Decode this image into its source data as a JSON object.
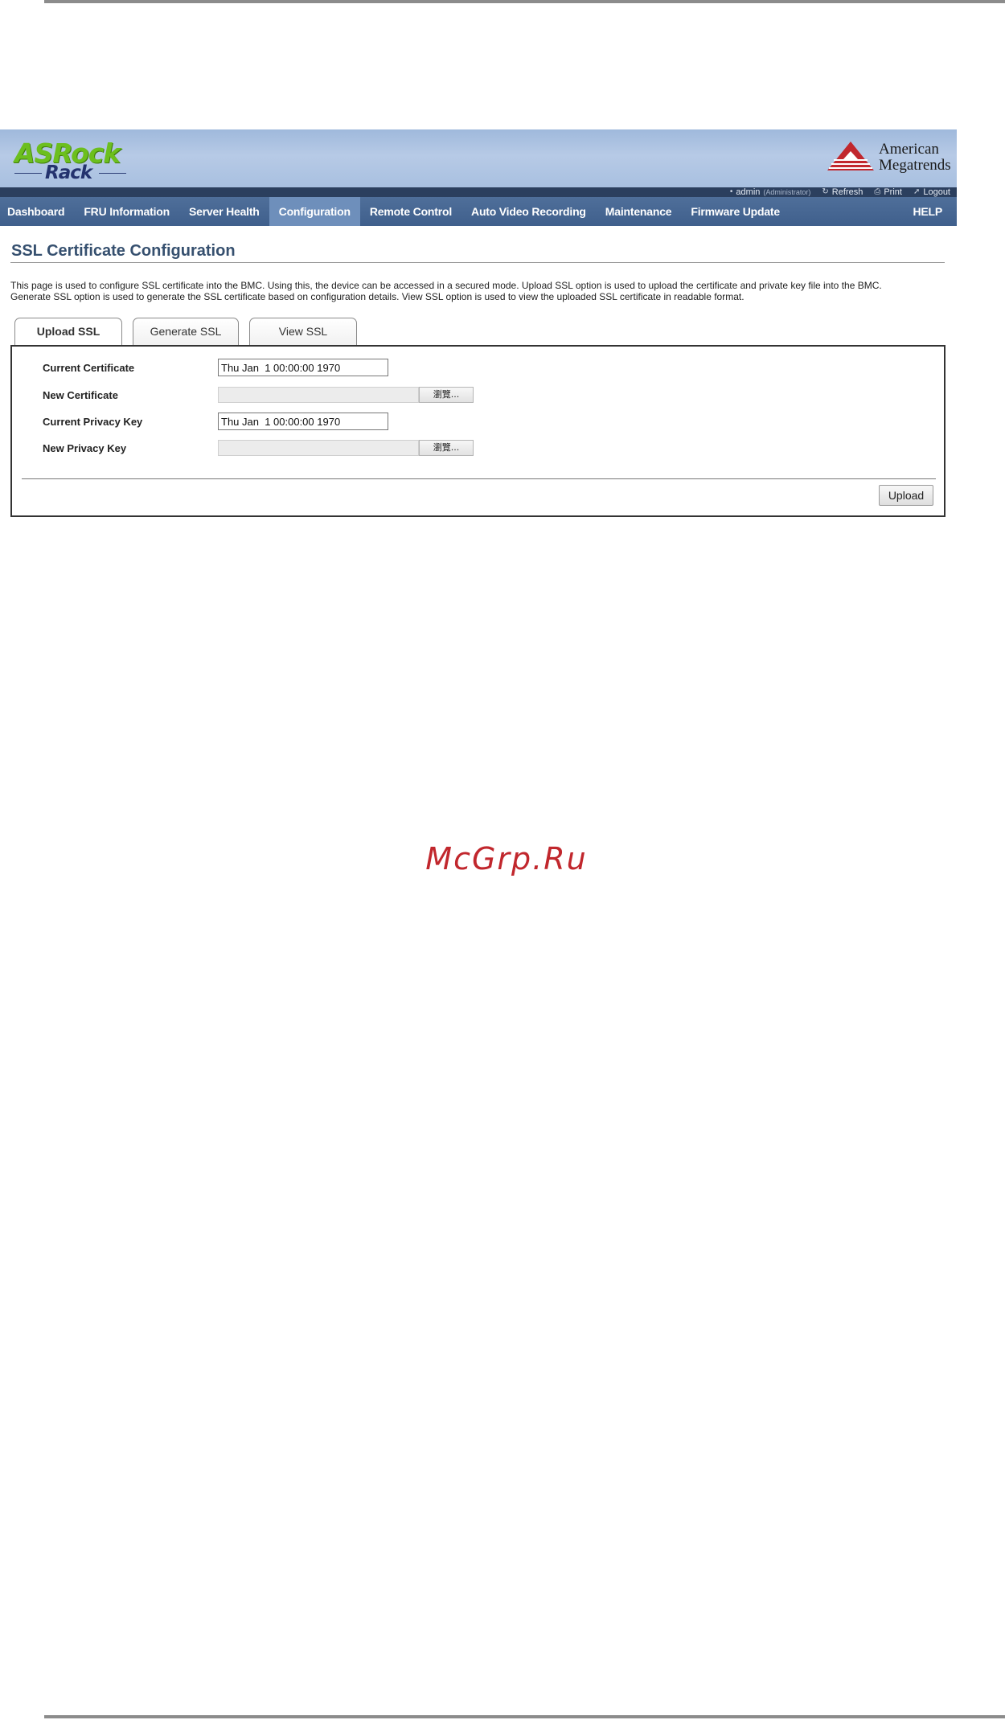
{
  "header": {
    "brand_main": "ASRock",
    "brand_sub": "Rack",
    "vendor_line1": "American",
    "vendor_line2": "Megatrends"
  },
  "userbar": {
    "user": "admin",
    "role": "(Administrator)",
    "refresh_label": "Refresh",
    "print_label": "Print",
    "logout_label": "Logout"
  },
  "nav": {
    "items": [
      {
        "label": "Dashboard"
      },
      {
        "label": "FRU Information"
      },
      {
        "label": "Server Health"
      },
      {
        "label": "Configuration"
      },
      {
        "label": "Remote Control"
      },
      {
        "label": "Auto Video Recording"
      },
      {
        "label": "Maintenance"
      },
      {
        "label": "Firmware Update"
      }
    ],
    "active": "Configuration",
    "help_label": "HELP"
  },
  "page": {
    "title": "SSL Certificate Configuration",
    "description_line1": "This page is used to configure SSL certificate into the BMC. Using this, the device can be accessed in a secured mode. Upload SSL option is used to upload the certificate and private key file into the BMC.",
    "description_line2": "Generate SSL option is used to generate the SSL certificate based on configuration details. View SSL option is used to view the uploaded SSL certificate in readable format."
  },
  "tabs": [
    {
      "label": "Upload SSL",
      "active": true
    },
    {
      "label": "Generate SSL",
      "active": false
    },
    {
      "label": "View SSL",
      "active": false
    }
  ],
  "form": {
    "current_certificate_label": "Current Certificate",
    "current_certificate_value": "Thu Jan  1 00:00:00 1970",
    "new_certificate_label": "New Certificate",
    "current_privacy_key_label": "Current Privacy Key",
    "current_privacy_key_value": "Thu Jan  1 00:00:00 1970",
    "new_privacy_key_label": "New Privacy Key",
    "browse_label": "瀏覽...",
    "upload_label": "Upload"
  },
  "watermark": "McGrp.Ru",
  "colors": {
    "banner": "#a8c0e0",
    "nav": "#46658f",
    "nav_active": "#6e8fbb",
    "brand_green": "#6cbf1e",
    "vendor_red": "#c1272d"
  },
  "icons": {
    "user": "bullet-icon",
    "refresh": "refresh-icon",
    "print": "print-icon",
    "logout": "logout-icon",
    "vendor": "ami-logo-icon"
  }
}
